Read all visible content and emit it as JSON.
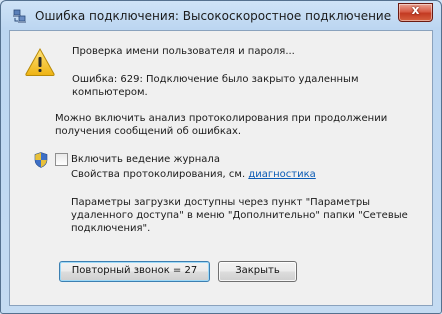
{
  "window": {
    "title": "Ошибка подключения: Высокоскоростное подключение",
    "close_label": "x"
  },
  "status": {
    "checking": "Проверка имени пользователя и пароля...",
    "error_line1": "Ошибка: 629: Подключение было закрыто удаленным",
    "error_line2": "компьютером."
  },
  "logging": {
    "info_line1": "Можно включить анализ протоколирования при продолжении",
    "info_line2": "получения сообщений об ошибках.",
    "checkbox_label": "Включить ведение журнала",
    "checkbox_checked": false,
    "properties_prefix": "Свойства протоколирования, см.",
    "diagnostics_link": "диагностика"
  },
  "params": {
    "line1": "Параметры загрузки доступны через пункт \"Параметры",
    "line2": "удаленного доступа\" в меню \"Дополнительно\" папки \"Сетевые",
    "line3": "подключения\"."
  },
  "buttons": {
    "redial": "Повторный звонок = 27",
    "close": "Закрыть"
  },
  "colors": {
    "link": "#0b5bb5",
    "close_button": "#c33a22",
    "warning": "#f3c21b"
  },
  "icons": {
    "title": "network-connection-icon",
    "warning": "warning-icon",
    "uac": "uac-shield-icon"
  }
}
